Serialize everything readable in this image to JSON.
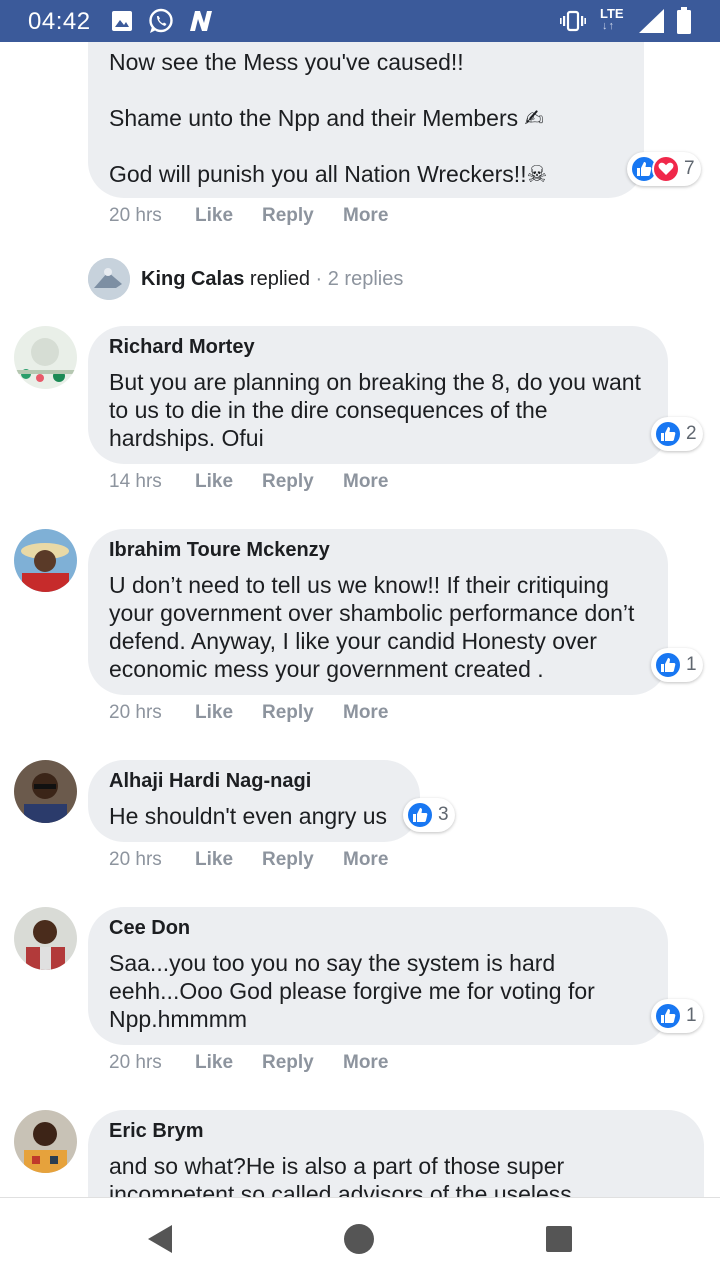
{
  "status_bar": {
    "time": "04:42",
    "network": "LTE",
    "icons": [
      "image-icon",
      "whatsapp-icon",
      "n-app-icon",
      "vibrate-icon",
      "signal-icon",
      "battery-icon"
    ]
  },
  "top_comment": {
    "lines": [
      "Now see the Mess you've caused!!",
      "Shame unto the Npp and their Members ✍",
      "God will punish you all Nation Wreckers!!☠"
    ],
    "time": "20 hrs",
    "reactions": "7"
  },
  "actions": {
    "like": "Like",
    "reply": "Reply",
    "more": "More"
  },
  "replies_summary": {
    "name": "King Calas",
    "verb": "replied",
    "count": "· 2 replies"
  },
  "comments": [
    {
      "author": "Richard Mortey",
      "text": "But you are planning on breaking the 8, do you want to us to die in the dire consequences of the hardships. Ofui",
      "time": "14 hrs",
      "reactions": "2"
    },
    {
      "author": "Ibrahim Toure Mckenzy",
      "text": "U don’t need to tell us we know!! If their critiquing your government over shambolic performance don’t defend. Anyway, I like your candid Honesty over economic mess your government created .",
      "time": "20 hrs",
      "reactions": "1"
    },
    {
      "author": "Alhaji Hardi Nag-nagi",
      "text": "He shouldn't even angry us",
      "time": "20 hrs",
      "reactions": "3"
    },
    {
      "author": "Cee Don",
      "text": "Saa...you too you no say the system is hard eehh...Ooo God please forgive me for voting for Npp.hmmmm",
      "time": "20 hrs",
      "reactions": "1"
    },
    {
      "author": "Eric Brym",
      "text": "and so what?He is also a part of those super incompetent so called advisors of the useless"
    }
  ],
  "colors": {
    "status_bar": "#3b5a9a",
    "bubble": "#eceef1",
    "like": "#1877f2",
    "love": "#f0284a",
    "meta": "#8d949e"
  }
}
